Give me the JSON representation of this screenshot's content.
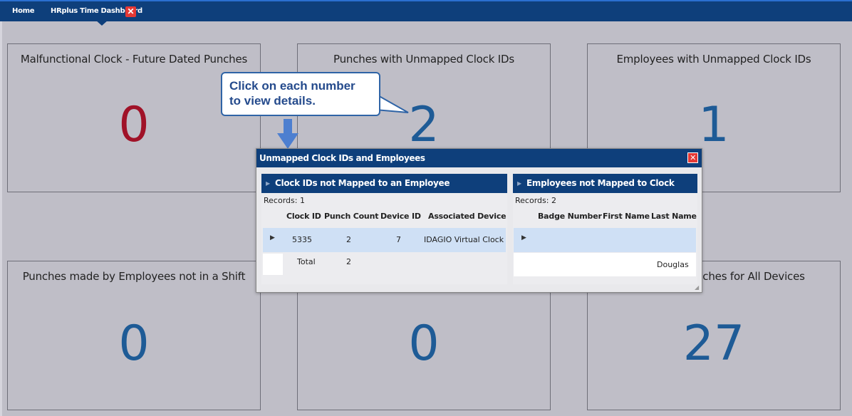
{
  "tabs": {
    "home": "Home",
    "dashboard": "HRplus Time Dashboard",
    "close_icon": "✕"
  },
  "tiles": [
    {
      "title": "Malfunctional Clock - Future Dated Punches",
      "value": "0",
      "color": "#a01228"
    },
    {
      "title": "Punches with Unmapped Clock IDs",
      "value": "2",
      "color": "#1e5b96"
    },
    {
      "title": "Employees with Unmapped Clock IDs",
      "value": "1",
      "color": "#1e5b96"
    },
    {
      "title": "Punches made by Employees not in a Shift",
      "value": "0",
      "color": "#1e5b96"
    },
    {
      "title": "",
      "value": "0",
      "color": "#1e5b96"
    },
    {
      "title": "nches for All Devices",
      "value": "27",
      "color": "#1e5b96"
    }
  ],
  "callout": {
    "line1": "Click on each number",
    "line2": "to view details."
  },
  "dialog": {
    "title": "Unmapped Clock IDs and Employees",
    "close_icon": "✕",
    "left_panel": {
      "title": "Clock IDs not Mapped to an Employee",
      "records": "Records:  1",
      "columns": [
        "Clock ID",
        "Punch Count",
        "Device ID",
        "Associated Device"
      ],
      "rows": [
        {
          "clock_id": "5335",
          "punch_count": "2",
          "device_id": "7",
          "associated_device": "IDAGIO Virtual Clock"
        }
      ],
      "total": {
        "label": "Total",
        "punch_count": "2"
      }
    },
    "right_panel": {
      "title": "Employees not Mapped to Clock",
      "records": "Records:  2",
      "columns": [
        "Badge Number",
        "First Name",
        "Last Name"
      ],
      "rows": [
        {
          "badge_number": "",
          "first_name": "",
          "last_name": ""
        },
        {
          "badge_number": "",
          "first_name": "",
          "last_name": "Douglas"
        }
      ]
    }
  }
}
